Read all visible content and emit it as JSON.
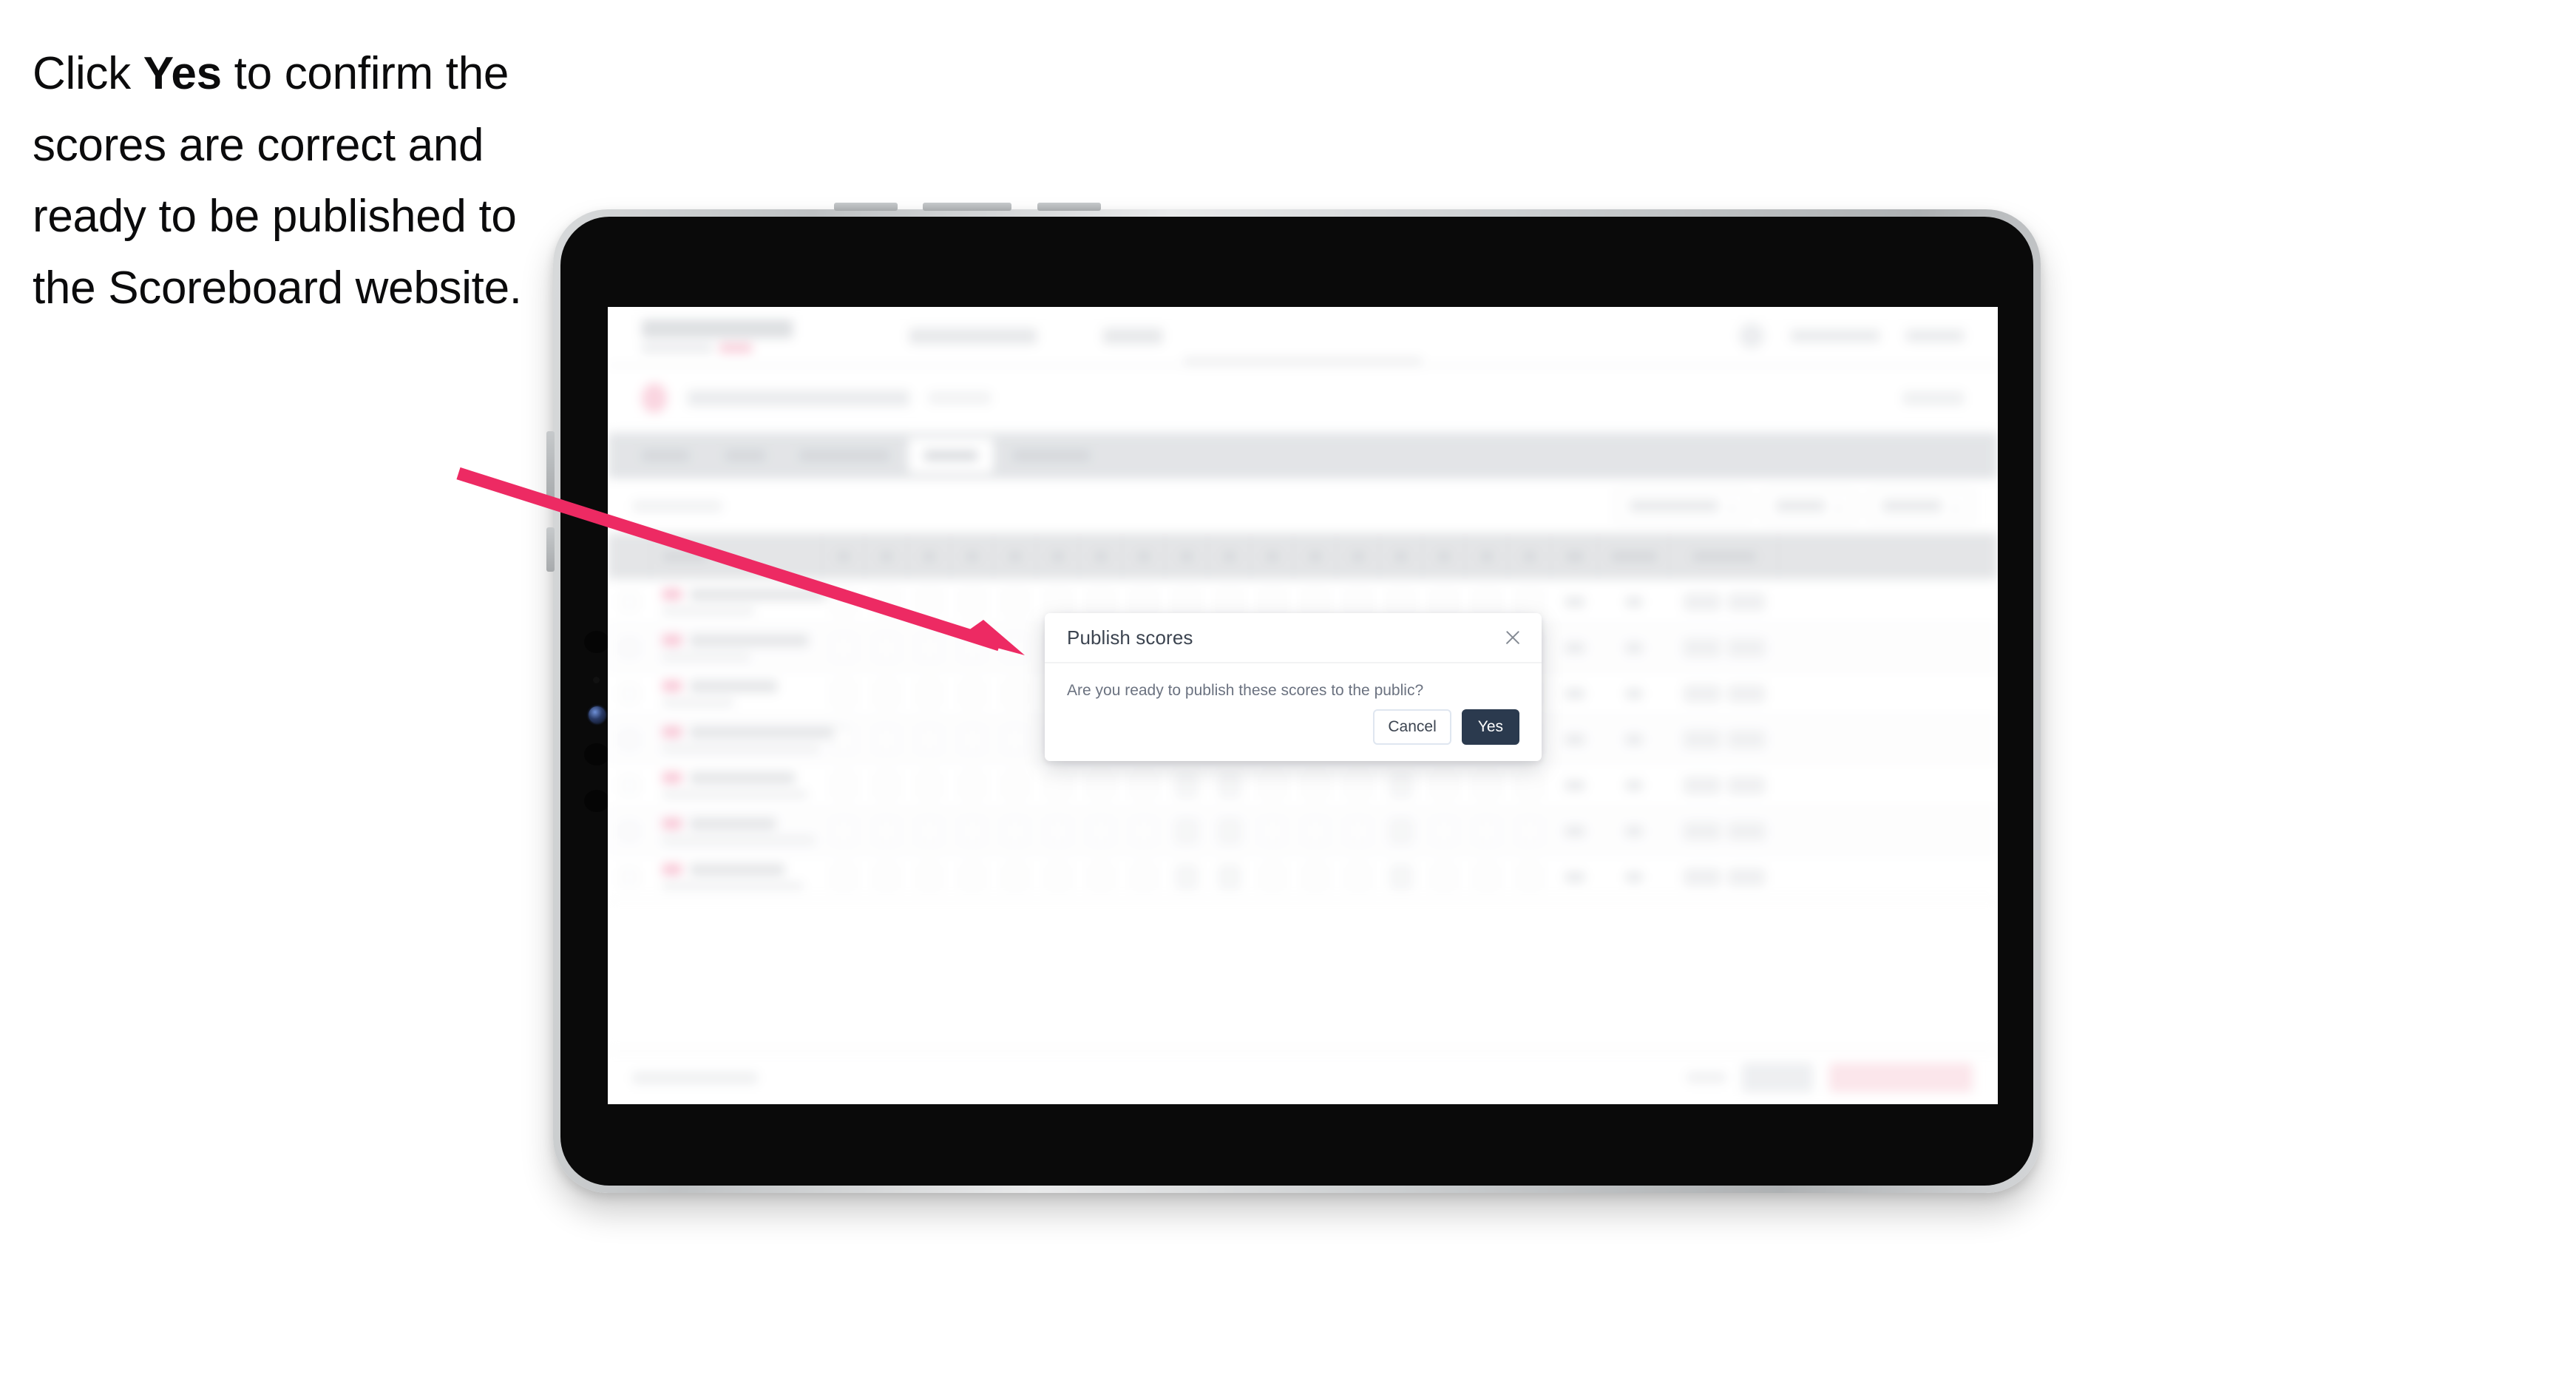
{
  "caption": {
    "before": "Click ",
    "emphasis": "Yes",
    "after": " to confirm the scores are correct and ready to be published to the Scoreboard website."
  },
  "modal": {
    "title": "Publish scores",
    "body": "Are you ready to publish these scores to the public?",
    "cancel_label": "Cancel",
    "confirm_label": "Yes",
    "close_icon": "close-icon"
  },
  "annotation": {
    "type": "arrow",
    "color": "#ed2a63",
    "points_to": "confirm-yes-button"
  },
  "colors": {
    "accent_pink": "#ed2a63",
    "confirm_button": "#2b3a4e",
    "cancel_border": "#dfe6f0",
    "tab_bar": "#d6d9dd",
    "table_header": "#d8dadd",
    "device_bezel": "#c9ccce",
    "screen_surround": "#0a0a0a"
  },
  "background_app": {
    "note": "blurred scoring application behind the modal",
    "tabs_count": 5,
    "active_tab_index": 3,
    "toolbar_controls": 3,
    "table_rows": 7,
    "score_columns": 17,
    "footer_buttons": 3
  }
}
